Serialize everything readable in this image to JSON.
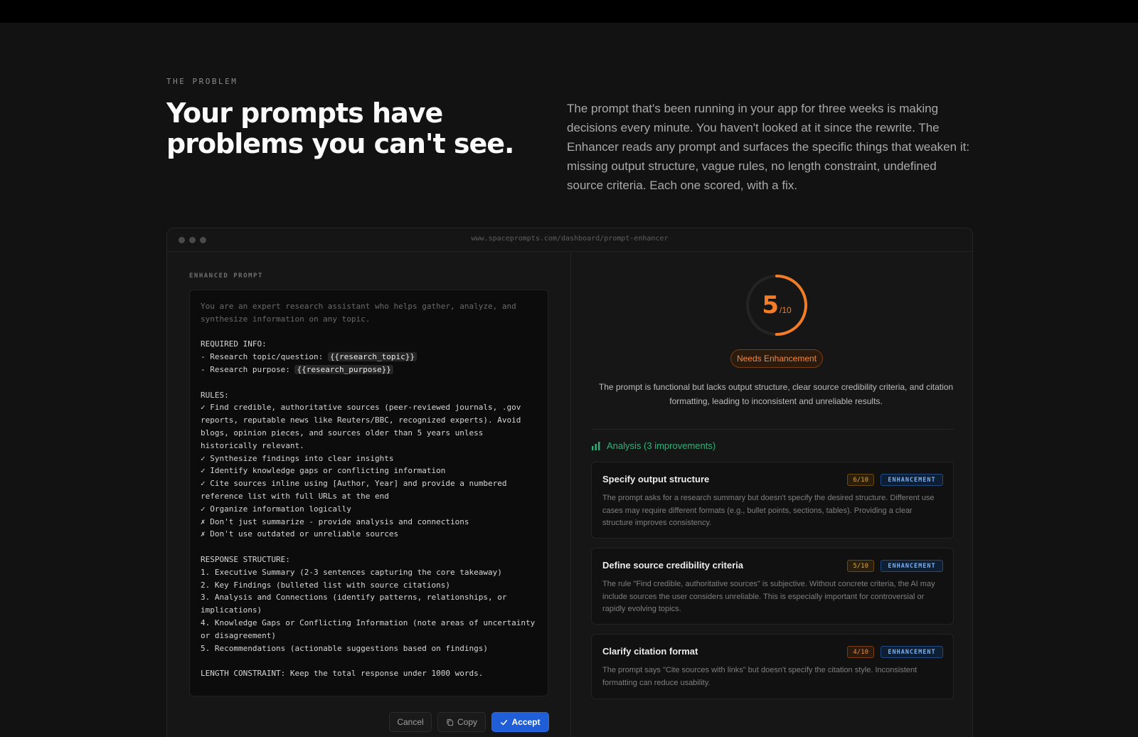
{
  "section": {
    "eyebrow": "THE PROBLEM",
    "headline": "Your prompts have problems you can't see.",
    "intro": "The prompt that's been running in your app for three weeks is making decisions every minute. You haven't looked at it since the rewrite. The Enhancer reads any prompt and surfaces the specific things that weaken it: missing output structure, vague rules, no length constraint, undefined source criteria. Each one scored, with a fix."
  },
  "window": {
    "url": "www.spaceprompts.com/dashboard/prompt-enhancer"
  },
  "editor": {
    "label": "ENHANCED PROMPT",
    "intro_1": "You are an expert research assistant who helps gather, analyze, and",
    "intro_2": "synthesize information on any topic.",
    "required_heading": "REQUIRED INFO:",
    "required_1_prefix": "- Research topic/question: ",
    "required_1_var": "{{research_topic}}",
    "required_2_prefix": "- Research purpose: ",
    "required_2_var": "{{research_purpose}}",
    "rules_heading": "RULES:",
    "rules": [
      "✓ Find credible, authoritative sources (peer-reviewed journals, .gov reports, reputable news like Reuters/BBC, recognized experts). Avoid blogs, opinion pieces, and sources older than 5 years unless historically relevant.",
      "✓ Synthesize findings into clear insights",
      "✓ Identify knowledge gaps or conflicting information",
      "✓ Cite sources inline using [Author, Year] and provide a numbered reference list with full URLs at the end",
      "✓ Organize information logically",
      "✗ Don't just summarize - provide analysis and connections",
      "✗ Don't use outdated or unreliable sources"
    ],
    "structure_heading": "RESPONSE STRUCTURE:",
    "structure": [
      "1. Executive Summary (2-3 sentences capturing the core takeaway)",
      "2. Key Findings (bulleted list with source citations)",
      "3. Analysis and Connections (identify patterns, relationships, or implications)",
      "4. Knowledge Gaps or Conflicting Information (note areas of uncertainty or disagreement)",
      "5. Recommendations (actionable suggestions based on findings)"
    ],
    "length": "LENGTH CONSTRAINT: Keep the total response under 1000 words.",
    "cancel_label": "Cancel",
    "copy_label": "Copy",
    "accept_label": "Accept"
  },
  "score": {
    "value": "5",
    "denominator": "/10",
    "fraction": 0.5,
    "color": "#f27d26",
    "status": "Needs Enhancement",
    "summary": "The prompt is functional but lacks output structure, clear source credibility criteria, and citation formatting, leading to inconsistent and unreliable results."
  },
  "analysis": {
    "heading": "Analysis (3 improvements)",
    "accent": "#2fb27a",
    "items": [
      {
        "title": "Specify output structure",
        "score": "6/10",
        "tag": "ENHANCEMENT",
        "body": "The prompt asks for a research summary but doesn't specify the desired structure. Different use cases may require different formats (e.g., bullet points, sections, tables). Providing a clear structure improves consistency."
      },
      {
        "title": "Define source credibility criteria",
        "score": "5/10",
        "tag": "ENHANCEMENT",
        "body": "The rule \"Find credible, authoritative sources\" is subjective. Without concrete criteria, the AI may include sources the user considers unreliable. This is especially important for controversial or rapidly evolving topics."
      },
      {
        "title": "Clarify citation format",
        "score": "4/10",
        "tag": "ENHANCEMENT",
        "body": "The prompt says \"Cite sources with links\" but doesn't specify the citation style. Inconsistent formatting can reduce usability."
      }
    ]
  }
}
